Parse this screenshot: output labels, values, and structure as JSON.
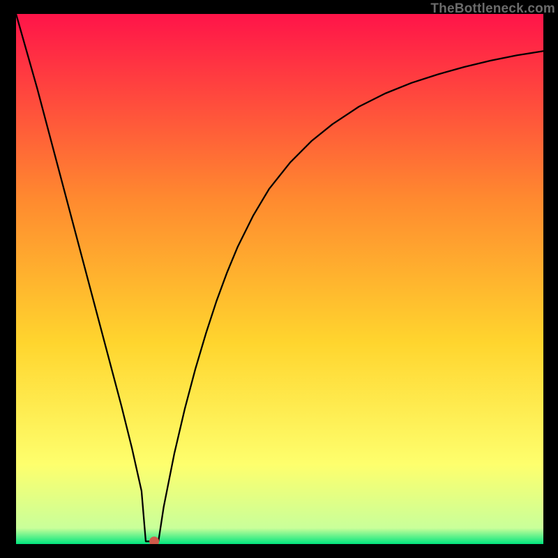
{
  "watermark": "TheBottleneck.com",
  "chart_data": {
    "type": "line",
    "title": "",
    "xlabel": "",
    "ylabel": "",
    "xlim": [
      0,
      100
    ],
    "ylim": [
      0,
      100
    ],
    "grid": false,
    "background_gradient": {
      "top": "#ff1449",
      "upper_mid": "#ff8a2f",
      "mid": "#ffd52e",
      "lower_mid": "#feff6d",
      "bottom": "#00e57e"
    },
    "series": [
      {
        "name": "bottleneck-curve",
        "color": "#000000",
        "x": [
          0,
          2,
          4,
          6,
          8,
          10,
          12,
          14,
          16,
          18,
          20,
          22,
          23.8,
          24.6,
          27,
          28,
          30,
          32,
          34,
          36,
          38,
          40,
          42,
          45,
          48,
          52,
          56,
          60,
          65,
          70,
          75,
          80,
          85,
          90,
          95,
          100
        ],
        "y": [
          100,
          93,
          86,
          78.5,
          71,
          63.5,
          56,
          48.5,
          41,
          33.5,
          26,
          18,
          10,
          0.5,
          0.5,
          7,
          17,
          25.5,
          33,
          39.7,
          45.8,
          51.2,
          56,
          62,
          67,
          72,
          76,
          79.2,
          82.5,
          85,
          87,
          88.6,
          90,
          91.2,
          92.2,
          93
        ]
      }
    ],
    "marker": {
      "name": "optimal-point",
      "x": 26.2,
      "y": 0.5,
      "color": "#cf5a4a",
      "radius_px": 7
    }
  }
}
